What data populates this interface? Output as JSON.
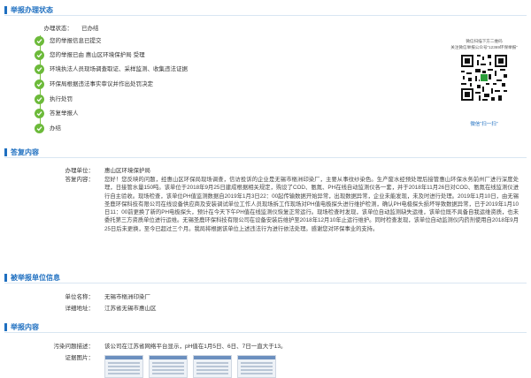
{
  "status_section": {
    "title": "举报办理状态",
    "status_label": "办理状态：",
    "status_value": "已办结",
    "steps": [
      "您的举报信息已提交",
      "您的举报已由 惠山区环境保护局 受理",
      "环境执法人员现场调查取证、采样监测、收集违法证据",
      "环保局根据违法事实审议并作出处罚决定",
      "执行处罚",
      "答复举报人",
      "办结"
    ],
    "qr": {
      "caption_line1": "微信扫描下方二维码",
      "caption_line2": "关注微信举报公众号“12369环保举报”",
      "scan_label": "微信“扫一扫”"
    }
  },
  "reply_section": {
    "title": "答复内容",
    "unit_label": "办理单位：",
    "unit_value": "惠山区环境保护局",
    "content_label": "答复内容：",
    "content_value": "您好！您反映的问题，经惠山区环保局现场调查，信访投诉的企业是无锡市樞洲印染厂，主要从事纹纱染色。生产废水经预处理后接管惠山环保水务前州厂进行深度处理，日接管水量150吨。该单位于2018年9月25日建成根据相关规定，购设了COD、氨氮、PH在线自动监测仪各一套，并于2018年11月26日对COD、氨氮在线监测仪进行自主验收。现场检查，该单位PH值监测数据自2019年1月3日22：00起传输数据开始异常，出现数据异常，企业未能发现，未及时进行处理。2019年1月10日，由无锡圣鹿环保科技有限公司在线设备供应商及安装调试单位工作人员现场拆工作现场对PH值电极探头进行维护检测，确认PH电极探头损坏导致数据异常，已于2019年1月10日11：00前更换了新的PH电极探头，预计在今天下午PH值在线监测仪恢复正常运行。现场检查时发现，该单位自动监测缺失运维，该单位既不具备自我运维资质，也未委托第三方资质单位进行运维。无锡圣鹿环保科技有限公司在设备安装后维护至2018年12月10年止运行维护。同时检查发现，该单位自动监测仪内药剂使用自2018年9月25日后未更换，至今已超过三个月。我局将根据该单位上述违法行为进行依法处理。感谢您对环保事业的支持。"
  },
  "target_section": {
    "title": "被举报单位信息",
    "name_label": "单位名称：",
    "name_value": "无锡市樞洲印染厂",
    "addr_label": "详细地址：",
    "addr_value": "江苏省无锡市惠山区"
  },
  "report_section": {
    "title": "举报内容",
    "desc_label": "污染问题描述：",
    "desc_value": "该公司在江苏省网络平台显示，pH值在1月5日、6日、7日一直大于13。",
    "photo_label": "证据图片："
  },
  "colors": {
    "accent": "#1e6fc0",
    "done": "#6cba3a"
  }
}
